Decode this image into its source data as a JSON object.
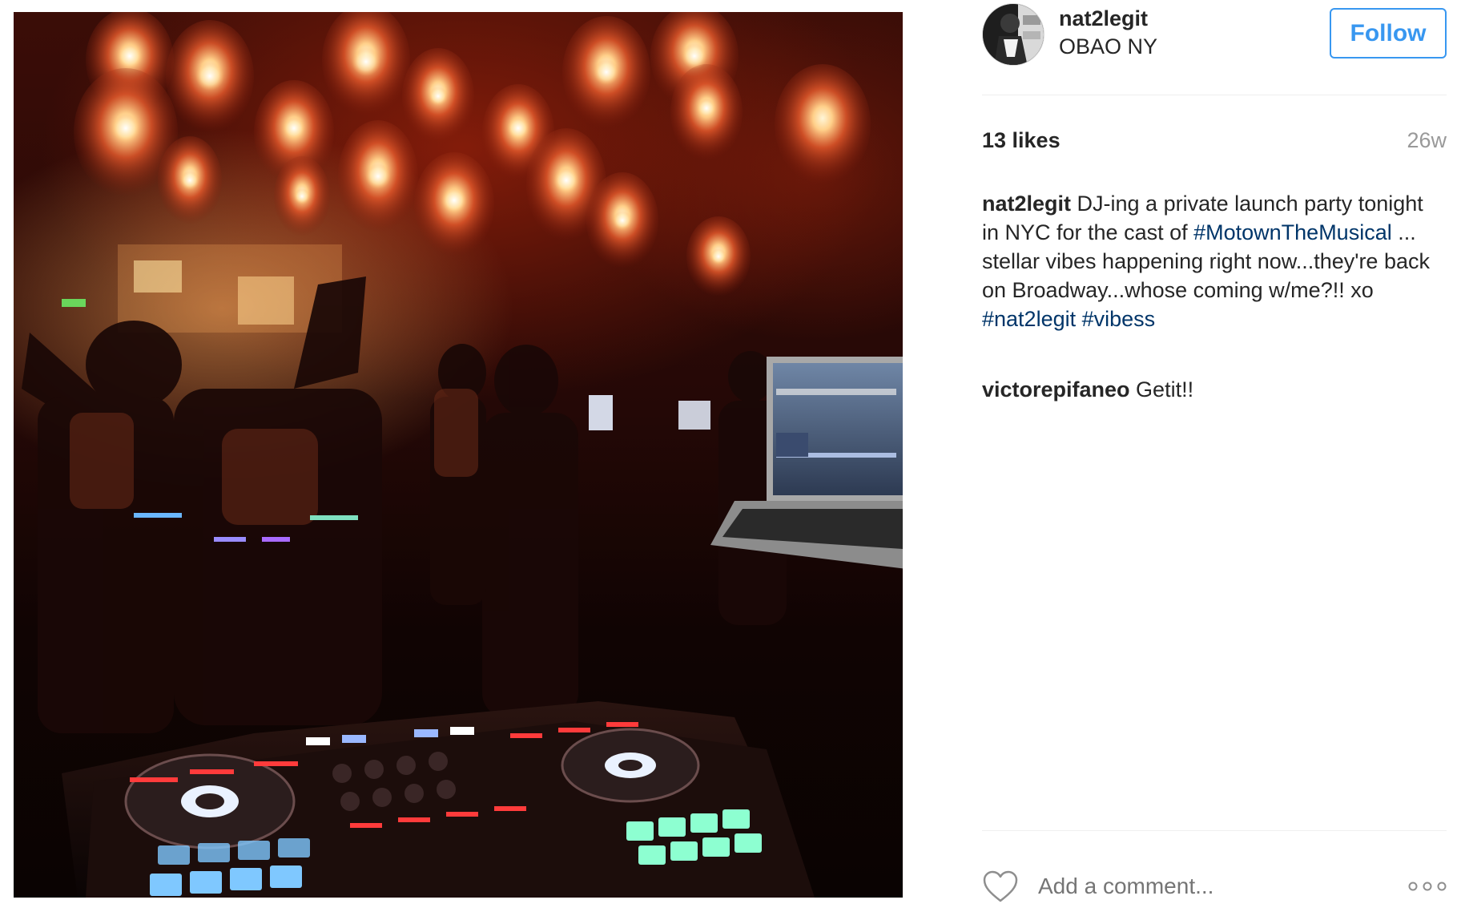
{
  "post": {
    "photo_alt": "DJ-ing a private launch party photo",
    "header": {
      "username": "nat2legit",
      "location": "OBAO NY",
      "follow_label": "Follow"
    },
    "likes": "13 likes",
    "age": "26w",
    "caption": {
      "user": "nat2legit",
      "text_1": " DJ-ing a private launch party tonight in NYC for the cast of ",
      "tag_1": "#MotownTheMusical",
      "text_2": " ... stellar vibes happening right now...they're back on Broadway...whose coming w/me?!! xo ",
      "tag_2": "#nat2legit",
      "text_3": " ",
      "tag_3": "#vibess"
    },
    "comments": [
      {
        "user": "victorepifaneo",
        "text": " Getit!!"
      }
    ],
    "add_comment_placeholder": "Add a comment..."
  },
  "icons": {
    "like": "heart-icon",
    "more": "more-options-icon"
  },
  "colors": {
    "link_blue": "#3897f0",
    "hashtag": "#003569",
    "muted": "#999999",
    "text": "#262626"
  }
}
